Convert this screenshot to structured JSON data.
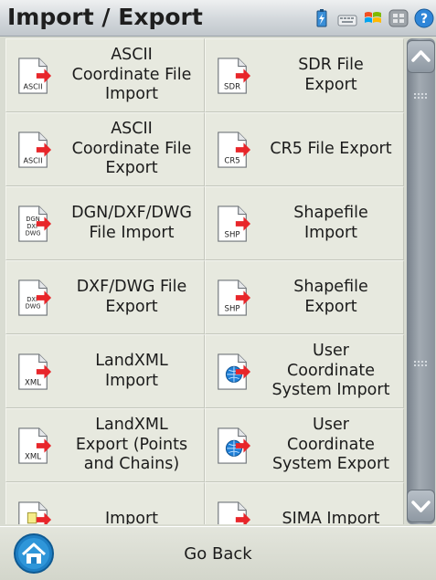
{
  "header": {
    "title": "Import / Export",
    "tray_icons": [
      "battery-icon",
      "keyboard-icon",
      "windows-start-icon",
      "window-switch-icon",
      "help-icon"
    ]
  },
  "tiles": [
    {
      "label": [
        "ASCII",
        "Coordinate File",
        "Import"
      ],
      "icon_text": "ASCII",
      "icon": "ascii-file-icon"
    },
    {
      "label": [
        "SDR File",
        "Export"
      ],
      "icon_text": "SDR",
      "icon": "sdr-file-icon"
    },
    {
      "label": [
        "ASCII",
        "Coordinate File",
        "Export"
      ],
      "icon_text": "ASCII",
      "icon": "ascii-file-icon"
    },
    {
      "label": [
        "CR5 File Export"
      ],
      "icon_text": "CR5",
      "icon": "cr5-file-icon"
    },
    {
      "label": [
        "DGN/DXF/DWG",
        "File Import"
      ],
      "icon_text": "DGN DXF DWG",
      "icon": "cad-file-icon"
    },
    {
      "label": [
        "Shapefile",
        "Import"
      ],
      "icon_text": "SHP",
      "icon": "shp-file-icon"
    },
    {
      "label": [
        "DXF/DWG File",
        "Export"
      ],
      "icon_text": "DXF DWG",
      "icon": "cad-file-icon"
    },
    {
      "label": [
        "Shapefile",
        "Export"
      ],
      "icon_text": "SHP",
      "icon": "shp-file-icon"
    },
    {
      "label": [
        "LandXML",
        "Import"
      ],
      "icon_text": "XML",
      "icon": "xml-file-icon"
    },
    {
      "label": [
        "User",
        "Coordinate",
        "System Import"
      ],
      "icon_text": "",
      "icon": "globe-file-icon"
    },
    {
      "label": [
        "LandXML",
        "Export (Points",
        "and Chains)"
      ],
      "icon_text": "XML",
      "icon": "xml-file-icon"
    },
    {
      "label": [
        "User",
        "Coordinate",
        "System Export"
      ],
      "icon_text": "",
      "icon": "globe-file-icon"
    },
    {
      "label": [
        "Import"
      ],
      "icon_text": "",
      "icon": "import-file-icon"
    },
    {
      "label": [
        "SIMA Import"
      ],
      "icon_text": "",
      "icon": "sima-file-icon"
    }
  ],
  "footer": {
    "back_label": "Go Back"
  },
  "colors": {
    "arrow": "#e8262a",
    "globe": "#1f7fd6",
    "home_button": "#1e7fc4"
  }
}
